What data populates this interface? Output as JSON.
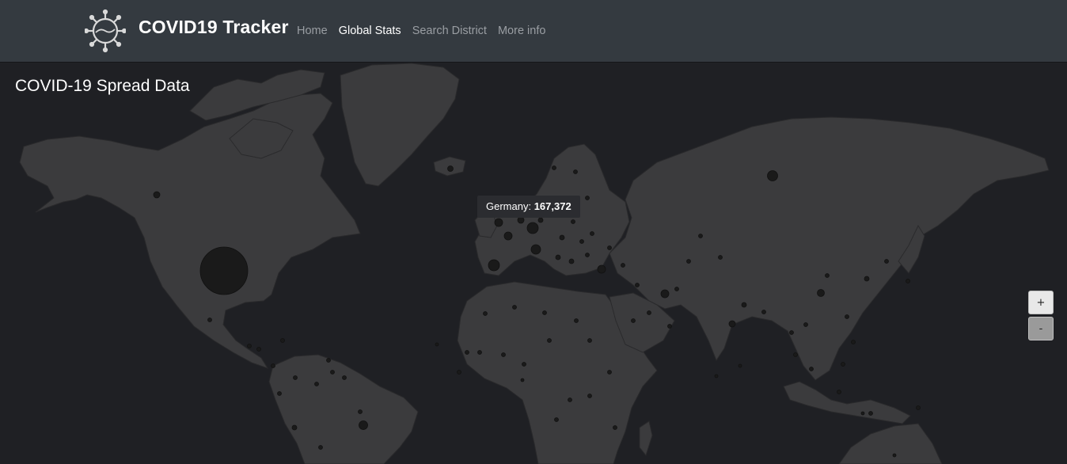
{
  "header": {
    "brand": "COVID19 Tracker",
    "logo_icon": "virus-icon",
    "nav": [
      {
        "label": "Home",
        "active": false
      },
      {
        "label": "Global Stats",
        "active": true
      },
      {
        "label": "Search District",
        "active": false
      },
      {
        "label": "More info",
        "active": false
      }
    ]
  },
  "main": {
    "title": "COVID-19 Spread Data",
    "tooltip": {
      "country": "Germany:",
      "value": "167,372"
    },
    "zoom": {
      "in_label": "+",
      "out_label": "-"
    }
  },
  "colors": {
    "navbar": "#343a40",
    "ocean": "#1f2024",
    "land": "#3b3b3d",
    "border": "#2a2a2c",
    "bubble": "#1a1a1a"
  }
}
